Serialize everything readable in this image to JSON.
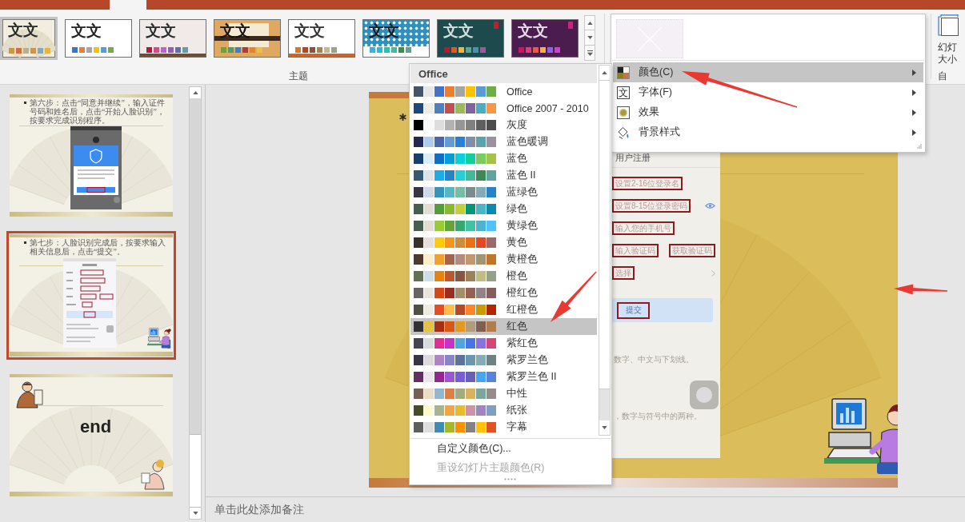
{
  "ribbon": {
    "themes": [
      {
        "selected": true,
        "color": "#f1eee0",
        "sample": {
          "text": "文文",
          "color": "#2a2a2a"
        },
        "decoration": {
          "kind": "fan"
        },
        "swatches": [
          {
            "color": "#c99a3d"
          },
          {
            "color": "#cf7040"
          },
          {
            "color": "#b5b38a"
          },
          {
            "color": "#c7975a"
          },
          {
            "color": "#82a9bd"
          },
          {
            "color": "#e4b445"
          }
        ]
      },
      {
        "selected": false,
        "color": "#ffffff",
        "sample": {
          "text": "文文",
          "color": "#222222"
        },
        "swatches": [
          {
            "color": "#4472c4"
          },
          {
            "color": "#ed7d31"
          },
          {
            "color": "#a5a5a5"
          },
          {
            "color": "#ffc000"
          },
          {
            "color": "#5b9bd5"
          },
          {
            "color": "#70ad47"
          }
        ]
      },
      {
        "selected": false,
        "color": "#f0ebe8",
        "sample": {
          "text": "文文",
          "color": "#2a2a2a"
        },
        "decoration": {
          "kind": "strip",
          "color": "#6e4e34"
        },
        "swatches": [
          {
            "color": "#b8173f"
          },
          {
            "color": "#e0458a"
          },
          {
            "color": "#c35fd8"
          },
          {
            "color": "#8a63b8"
          },
          {
            "color": "#5b70b5"
          },
          {
            "color": "#6a9aa2"
          }
        ]
      },
      {
        "selected": false,
        "color": "#dfa863",
        "sample": {
          "text": "文文",
          "color": "#111111"
        },
        "decoration": {
          "kind": "board",
          "color": "#3b2a1c"
        },
        "swatches": [
          {
            "color": "#6aa33a"
          },
          {
            "color": "#43a36b"
          },
          {
            "color": "#4a7eb5"
          },
          {
            "color": "#b8373b"
          },
          {
            "color": "#e7832a"
          },
          {
            "color": "#f0c03a"
          }
        ]
      },
      {
        "selected": false,
        "color": "#ffffff",
        "sample": {
          "text": "文文",
          "color": "#333333"
        },
        "decoration": {
          "kind": "bar",
          "color": "#d0632a"
        },
        "swatches": [
          {
            "color": "#e2741c"
          },
          {
            "color": "#b5471f"
          },
          {
            "color": "#8f5136"
          },
          {
            "color": "#a08555"
          },
          {
            "color": "#c5b88a"
          },
          {
            "color": "#9aa28a"
          }
        ]
      },
      {
        "selected": false,
        "color": "#ffffff",
        "sample": {
          "text": "文文",
          "color": "#1a1a1a"
        },
        "decoration": {
          "kind": "pattern",
          "color": "#2f8fbf"
        },
        "swatches": [
          {
            "color": "#35b0e8"
          },
          {
            "color": "#1fbfdc"
          },
          {
            "color": "#22c3b3"
          },
          {
            "color": "#3cbf9a"
          },
          {
            "color": "#3a8f4e"
          },
          {
            "color": "#5aa29e"
          }
        ]
      },
      {
        "selected": false,
        "color": "#1d4a4d",
        "sample": {
          "text": "文文",
          "color": "#d5e2e2"
        },
        "decoration": {
          "kind": "tag",
          "color": "#c0202a"
        },
        "swatches": [
          {
            "color": "#c8102e"
          },
          {
            "color": "#e05724"
          },
          {
            "color": "#f2b632"
          },
          {
            "color": "#5fa58e"
          },
          {
            "color": "#4f8eb2"
          },
          {
            "color": "#9a5aa0"
          }
        ]
      },
      {
        "selected": false,
        "color": "#4b1d4f",
        "sample": {
          "text": "文文",
          "color": "#eadcea"
        },
        "decoration": {
          "kind": "tag",
          "color": "#d0207a"
        },
        "swatches": [
          {
            "color": "#c8175e"
          },
          {
            "color": "#e33a7a"
          },
          {
            "color": "#f05a3a"
          },
          {
            "color": "#f5b138"
          },
          {
            "color": "#9460e3"
          },
          {
            "color": "#d040d0"
          }
        ]
      }
    ],
    "group_label": "主题",
    "slide_size": {
      "label_lines": [
        "幻灯",
        "大小"
      ],
      "group_label": "自"
    }
  },
  "slide_panel": {
    "slides": [
      {
        "kind": "dialog-step",
        "text": "第六步：点击“同意并继续”，输入证件号码和姓名后，点击“开始人脸识别”，按要求完成识别程序。",
        "selected": false
      },
      {
        "kind": "form-step",
        "text": "第七步：人脸识别完成后，按要求输入相关信息后，点击“提交”。",
        "selected": true
      },
      {
        "kind": "end",
        "text": "end",
        "selected": false
      }
    ]
  },
  "slide": {
    "screenshot": {
      "title": "用户注册",
      "fields": [
        {
          "kind": "input",
          "placeholder": "设置2-16位登录名"
        },
        {
          "kind": "password",
          "placeholder": "设置8-15位登录密码"
        },
        {
          "kind": "input",
          "placeholder": "输入您的手机号"
        },
        {
          "kind": "code",
          "placeholder": "输入验证码",
          "button": "获取验证码"
        },
        {
          "kind": "select",
          "placeholder": "选择"
        }
      ],
      "submit": "提交",
      "hints": [
        "数字、中文与下划线。",
        "，数字与符号中的两种。"
      ]
    }
  },
  "notes": {
    "placeholder": "单击此处添加备注"
  },
  "variants_menu": {
    "items": [
      {
        "kind": "colors",
        "label": "颜色(C)",
        "selected": true
      },
      {
        "kind": "fonts",
        "icon_text": "文",
        "label": "字体(F)",
        "selected": false
      },
      {
        "kind": "effects",
        "label": "效果",
        "selected": false
      },
      {
        "kind": "background",
        "label": "背景样式",
        "selected": false
      }
    ]
  },
  "color_menu": {
    "header": "Office",
    "themes": [
      {
        "name": "Office",
        "selected": false,
        "swatches": [
          {
            "color": "#44546a"
          },
          {
            "color": "#e7e6e6"
          },
          {
            "color": "#4472c4"
          },
          {
            "color": "#ed7d31"
          },
          {
            "color": "#a5a5a5"
          },
          {
            "color": "#ffc000"
          },
          {
            "color": "#5b9bd5"
          },
          {
            "color": "#70ad47"
          }
        ]
      },
      {
        "name": "Office 2007 - 2010",
        "selected": false,
        "swatches": [
          {
            "color": "#1f497d"
          },
          {
            "color": "#eeece1"
          },
          {
            "color": "#4f81bd"
          },
          {
            "color": "#c0504d"
          },
          {
            "color": "#9bbb59"
          },
          {
            "color": "#8064a2"
          },
          {
            "color": "#4bacc6"
          },
          {
            "color": "#f79646"
          }
        ]
      },
      {
        "name": "灰度",
        "selected": false,
        "swatches": [
          {
            "color": "#000000"
          },
          {
            "color": "#f8f8f8"
          },
          {
            "color": "#dddddd"
          },
          {
            "color": "#b2b2b2"
          },
          {
            "color": "#969696"
          },
          {
            "color": "#808080"
          },
          {
            "color": "#5f5f5f"
          },
          {
            "color": "#4d4d4d"
          }
        ]
      },
      {
        "name": "蓝色暖调",
        "selected": false,
        "swatches": [
          {
            "color": "#242852"
          },
          {
            "color": "#acccea"
          },
          {
            "color": "#4a66ac"
          },
          {
            "color": "#629dd1"
          },
          {
            "color": "#297fd5"
          },
          {
            "color": "#7f8fa9"
          },
          {
            "color": "#5aa2ae"
          },
          {
            "color": "#9d90a0"
          }
        ]
      },
      {
        "name": "蓝色",
        "selected": false,
        "swatches": [
          {
            "color": "#17406d"
          },
          {
            "color": "#dbeff9"
          },
          {
            "color": "#0f6fc6"
          },
          {
            "color": "#009dd9"
          },
          {
            "color": "#0bd0d9"
          },
          {
            "color": "#10cf9b"
          },
          {
            "color": "#7cca62"
          },
          {
            "color": "#a5c249"
          }
        ]
      },
      {
        "name": "蓝色 II",
        "selected": false,
        "swatches": [
          {
            "color": "#335b74"
          },
          {
            "color": "#dfe3e5"
          },
          {
            "color": "#1cade4"
          },
          {
            "color": "#2683c6"
          },
          {
            "color": "#27ced7"
          },
          {
            "color": "#42ba97"
          },
          {
            "color": "#3e8853"
          },
          {
            "color": "#62a39f"
          }
        ]
      },
      {
        "name": "蓝绿色",
        "selected": false,
        "swatches": [
          {
            "color": "#373545"
          },
          {
            "color": "#cedbe6"
          },
          {
            "color": "#3494ba"
          },
          {
            "color": "#58b6c0"
          },
          {
            "color": "#75bda7"
          },
          {
            "color": "#7a8c8e"
          },
          {
            "color": "#84acb6"
          },
          {
            "color": "#2683c6"
          }
        ]
      },
      {
        "name": "绿色",
        "selected": false,
        "swatches": [
          {
            "color": "#455f51"
          },
          {
            "color": "#e3ded1"
          },
          {
            "color": "#549e39"
          },
          {
            "color": "#8ab833"
          },
          {
            "color": "#c0cf3a"
          },
          {
            "color": "#029676"
          },
          {
            "color": "#4ab5c4"
          },
          {
            "color": "#0989b1"
          }
        ]
      },
      {
        "name": "黄绿色",
        "selected": false,
        "swatches": [
          {
            "color": "#455f51"
          },
          {
            "color": "#e3ded1"
          },
          {
            "color": "#99cb38"
          },
          {
            "color": "#63a537"
          },
          {
            "color": "#37a76f"
          },
          {
            "color": "#44c1a3"
          },
          {
            "color": "#4eb3cf"
          },
          {
            "color": "#51c3f9"
          }
        ]
      },
      {
        "name": "黄色",
        "selected": false,
        "swatches": [
          {
            "color": "#39302a"
          },
          {
            "color": "#e5dedb"
          },
          {
            "color": "#ffca08"
          },
          {
            "color": "#f8931d"
          },
          {
            "color": "#ce8d3e"
          },
          {
            "color": "#ec7016"
          },
          {
            "color": "#e64823"
          },
          {
            "color": "#9c6a6a"
          }
        ]
      },
      {
        "name": "黄橙色",
        "selected": false,
        "swatches": [
          {
            "color": "#4e3b30"
          },
          {
            "color": "#fbeec9"
          },
          {
            "color": "#f0a22e"
          },
          {
            "color": "#a5644e"
          },
          {
            "color": "#b58b80"
          },
          {
            "color": "#c3986d"
          },
          {
            "color": "#a19574"
          },
          {
            "color": "#c17529"
          }
        ]
      },
      {
        "name": "橙色",
        "selected": false,
        "swatches": [
          {
            "color": "#637052"
          },
          {
            "color": "#ccddea"
          },
          {
            "color": "#e48312"
          },
          {
            "color": "#bd582c"
          },
          {
            "color": "#865640"
          },
          {
            "color": "#9b8357"
          },
          {
            "color": "#c2bc80"
          },
          {
            "color": "#94a088"
          }
        ]
      },
      {
        "name": "橙红色",
        "selected": false,
        "swatches": [
          {
            "color": "#696464"
          },
          {
            "color": "#e9e5dc"
          },
          {
            "color": "#d34817"
          },
          {
            "color": "#9b2d1f"
          },
          {
            "color": "#a28e6a"
          },
          {
            "color": "#956251"
          },
          {
            "color": "#918485"
          },
          {
            "color": "#855d5d"
          }
        ]
      },
      {
        "name": "红橙色",
        "selected": false,
        "swatches": [
          {
            "color": "#505046"
          },
          {
            "color": "#eeece1"
          },
          {
            "color": "#e84c22"
          },
          {
            "color": "#ffbd47"
          },
          {
            "color": "#b64926"
          },
          {
            "color": "#ff8427"
          },
          {
            "color": "#cc9900"
          },
          {
            "color": "#b22600"
          }
        ]
      },
      {
        "name": "红色",
        "selected": true,
        "swatches": [
          {
            "color": "#323232"
          },
          {
            "color": "#e5c243"
          },
          {
            "color": "#a5300f"
          },
          {
            "color": "#d55816"
          },
          {
            "color": "#e19825"
          },
          {
            "color": "#b19c7d"
          },
          {
            "color": "#7f5f52"
          },
          {
            "color": "#b27d49"
          }
        ]
      },
      {
        "name": "紫红色",
        "selected": false,
        "swatches": [
          {
            "color": "#454551"
          },
          {
            "color": "#d8d9dc"
          },
          {
            "color": "#e32d91"
          },
          {
            "color": "#c830cc"
          },
          {
            "color": "#4ea6dc"
          },
          {
            "color": "#4775e7"
          },
          {
            "color": "#8971e1"
          },
          {
            "color": "#d54773"
          }
        ]
      },
      {
        "name": "紫罗兰色",
        "selected": false,
        "swatches": [
          {
            "color": "#373545"
          },
          {
            "color": "#dcd8dc"
          },
          {
            "color": "#ad84c6"
          },
          {
            "color": "#8784c7"
          },
          {
            "color": "#5d739a"
          },
          {
            "color": "#6997af"
          },
          {
            "color": "#84acb6"
          },
          {
            "color": "#6f8183"
          }
        ]
      },
      {
        "name": "紫罗兰色 II",
        "selected": false,
        "swatches": [
          {
            "color": "#632e62"
          },
          {
            "color": "#eae5eb"
          },
          {
            "color": "#92278f"
          },
          {
            "color": "#9b57d3"
          },
          {
            "color": "#755dd9"
          },
          {
            "color": "#665eb8"
          },
          {
            "color": "#45a5ed"
          },
          {
            "color": "#5982db"
          }
        ]
      },
      {
        "name": "中性",
        "selected": false,
        "swatches": [
          {
            "color": "#775f55"
          },
          {
            "color": "#ebddc3"
          },
          {
            "color": "#94b6d2"
          },
          {
            "color": "#dd8047"
          },
          {
            "color": "#a5ab81"
          },
          {
            "color": "#d8b25c"
          },
          {
            "color": "#7ba79d"
          },
          {
            "color": "#968c8c"
          }
        ]
      },
      {
        "name": "纸张",
        "selected": false,
        "swatches": [
          {
            "color": "#444d26"
          },
          {
            "color": "#fefac9"
          },
          {
            "color": "#a5b592"
          },
          {
            "color": "#f3a447"
          },
          {
            "color": "#e7bc29"
          },
          {
            "color": "#d092a7"
          },
          {
            "color": "#9c85c0"
          },
          {
            "color": "#809ec2"
          }
        ]
      },
      {
        "name": "字幕",
        "selected": false,
        "swatches": [
          {
            "color": "#5e5e5e"
          },
          {
            "color": "#dddddd"
          },
          {
            "color": "#418ab3"
          },
          {
            "color": "#a6b727"
          },
          {
            "color": "#f69200"
          },
          {
            "color": "#838383"
          },
          {
            "color": "#fec306"
          },
          {
            "color": "#df5327"
          }
        ]
      }
    ],
    "actions": [
      {
        "label": "自定义颜色(C)...",
        "disabled": false
      },
      {
        "label": "重设幻灯片主题颜色(R)",
        "disabled": true
      }
    ]
  }
}
